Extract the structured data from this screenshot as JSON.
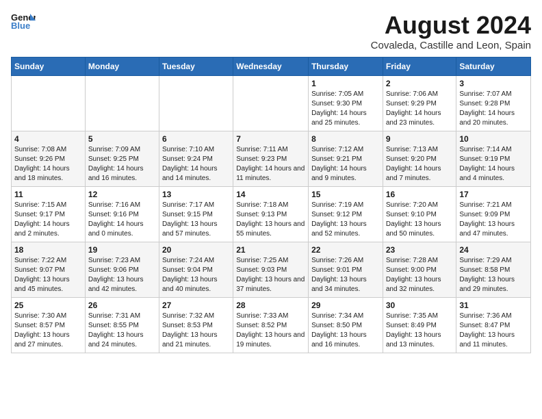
{
  "header": {
    "logo_line1": "General",
    "logo_line2": "Blue",
    "month_title": "August 2024",
    "location": "Covaleda, Castille and Leon, Spain"
  },
  "weekdays": [
    "Sunday",
    "Monday",
    "Tuesday",
    "Wednesday",
    "Thursday",
    "Friday",
    "Saturday"
  ],
  "weeks": [
    [
      {
        "day": "",
        "info": ""
      },
      {
        "day": "",
        "info": ""
      },
      {
        "day": "",
        "info": ""
      },
      {
        "day": "",
        "info": ""
      },
      {
        "day": "1",
        "info": "Sunrise: 7:05 AM\nSunset: 9:30 PM\nDaylight: 14 hours and 25 minutes."
      },
      {
        "day": "2",
        "info": "Sunrise: 7:06 AM\nSunset: 9:29 PM\nDaylight: 14 hours and 23 minutes."
      },
      {
        "day": "3",
        "info": "Sunrise: 7:07 AM\nSunset: 9:28 PM\nDaylight: 14 hours and 20 minutes."
      }
    ],
    [
      {
        "day": "4",
        "info": "Sunrise: 7:08 AM\nSunset: 9:26 PM\nDaylight: 14 hours and 18 minutes."
      },
      {
        "day": "5",
        "info": "Sunrise: 7:09 AM\nSunset: 9:25 PM\nDaylight: 14 hours and 16 minutes."
      },
      {
        "day": "6",
        "info": "Sunrise: 7:10 AM\nSunset: 9:24 PM\nDaylight: 14 hours and 14 minutes."
      },
      {
        "day": "7",
        "info": "Sunrise: 7:11 AM\nSunset: 9:23 PM\nDaylight: 14 hours and 11 minutes."
      },
      {
        "day": "8",
        "info": "Sunrise: 7:12 AM\nSunset: 9:21 PM\nDaylight: 14 hours and 9 minutes."
      },
      {
        "day": "9",
        "info": "Sunrise: 7:13 AM\nSunset: 9:20 PM\nDaylight: 14 hours and 7 minutes."
      },
      {
        "day": "10",
        "info": "Sunrise: 7:14 AM\nSunset: 9:19 PM\nDaylight: 14 hours and 4 minutes."
      }
    ],
    [
      {
        "day": "11",
        "info": "Sunrise: 7:15 AM\nSunset: 9:17 PM\nDaylight: 14 hours and 2 minutes."
      },
      {
        "day": "12",
        "info": "Sunrise: 7:16 AM\nSunset: 9:16 PM\nDaylight: 14 hours and 0 minutes."
      },
      {
        "day": "13",
        "info": "Sunrise: 7:17 AM\nSunset: 9:15 PM\nDaylight: 13 hours and 57 minutes."
      },
      {
        "day": "14",
        "info": "Sunrise: 7:18 AM\nSunset: 9:13 PM\nDaylight: 13 hours and 55 minutes."
      },
      {
        "day": "15",
        "info": "Sunrise: 7:19 AM\nSunset: 9:12 PM\nDaylight: 13 hours and 52 minutes."
      },
      {
        "day": "16",
        "info": "Sunrise: 7:20 AM\nSunset: 9:10 PM\nDaylight: 13 hours and 50 minutes."
      },
      {
        "day": "17",
        "info": "Sunrise: 7:21 AM\nSunset: 9:09 PM\nDaylight: 13 hours and 47 minutes."
      }
    ],
    [
      {
        "day": "18",
        "info": "Sunrise: 7:22 AM\nSunset: 9:07 PM\nDaylight: 13 hours and 45 minutes."
      },
      {
        "day": "19",
        "info": "Sunrise: 7:23 AM\nSunset: 9:06 PM\nDaylight: 13 hours and 42 minutes."
      },
      {
        "day": "20",
        "info": "Sunrise: 7:24 AM\nSunset: 9:04 PM\nDaylight: 13 hours and 40 minutes."
      },
      {
        "day": "21",
        "info": "Sunrise: 7:25 AM\nSunset: 9:03 PM\nDaylight: 13 hours and 37 minutes."
      },
      {
        "day": "22",
        "info": "Sunrise: 7:26 AM\nSunset: 9:01 PM\nDaylight: 13 hours and 34 minutes."
      },
      {
        "day": "23",
        "info": "Sunrise: 7:28 AM\nSunset: 9:00 PM\nDaylight: 13 hours and 32 minutes."
      },
      {
        "day": "24",
        "info": "Sunrise: 7:29 AM\nSunset: 8:58 PM\nDaylight: 13 hours and 29 minutes."
      }
    ],
    [
      {
        "day": "25",
        "info": "Sunrise: 7:30 AM\nSunset: 8:57 PM\nDaylight: 13 hours and 27 minutes."
      },
      {
        "day": "26",
        "info": "Sunrise: 7:31 AM\nSunset: 8:55 PM\nDaylight: 13 hours and 24 minutes."
      },
      {
        "day": "27",
        "info": "Sunrise: 7:32 AM\nSunset: 8:53 PM\nDaylight: 13 hours and 21 minutes."
      },
      {
        "day": "28",
        "info": "Sunrise: 7:33 AM\nSunset: 8:52 PM\nDaylight: 13 hours and 19 minutes."
      },
      {
        "day": "29",
        "info": "Sunrise: 7:34 AM\nSunset: 8:50 PM\nDaylight: 13 hours and 16 minutes."
      },
      {
        "day": "30",
        "info": "Sunrise: 7:35 AM\nSunset: 8:49 PM\nDaylight: 13 hours and 13 minutes."
      },
      {
        "day": "31",
        "info": "Sunrise: 7:36 AM\nSunset: 8:47 PM\nDaylight: 13 hours and 11 minutes."
      }
    ]
  ]
}
